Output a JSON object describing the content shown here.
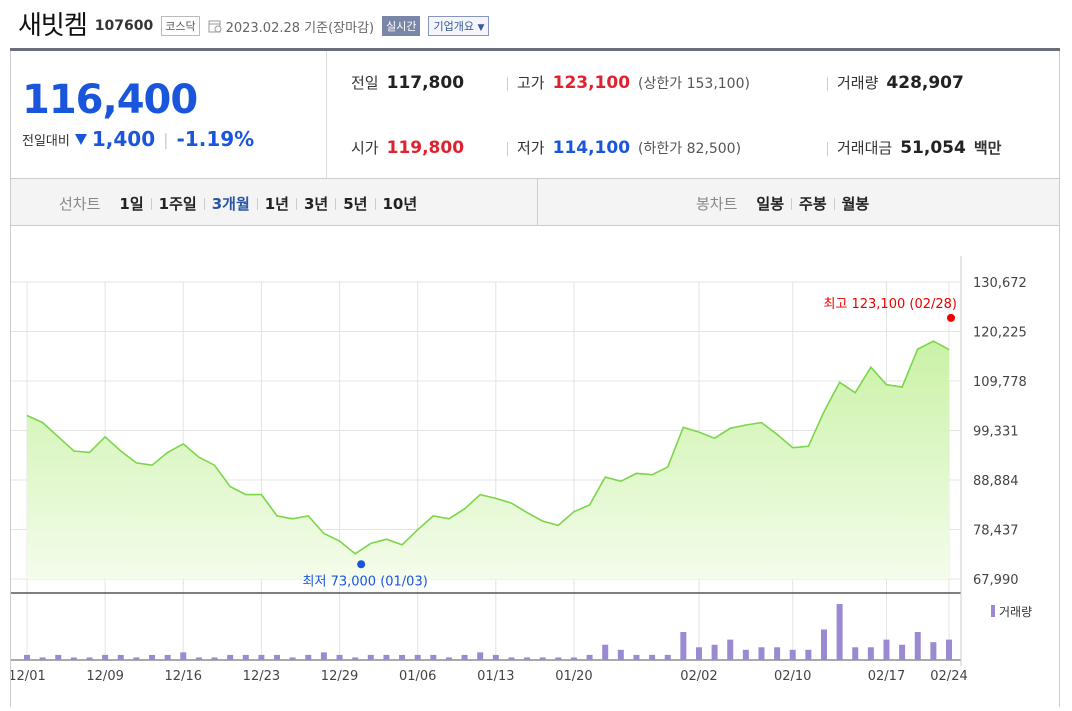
{
  "header": {
    "name": "새빗켐",
    "code": "107600",
    "market": "코스닥",
    "date_label": "2023.02.28  기준(장마감)",
    "live_label": "실시간",
    "corp_label": "기업개요"
  },
  "price": {
    "current": "116,400",
    "change_label": "전일대비",
    "change_amount": "1,400",
    "change_pct": "-1.19%"
  },
  "stats": {
    "prev_label": "전일",
    "prev_value": "117,800",
    "high_label": "고가",
    "high_value": "123,100",
    "upper_limit": "(상한가 153,100)",
    "volume_label": "거래량",
    "volume_value": "428,907",
    "open_label": "시가",
    "open_value": "119,800",
    "low_label": "저가",
    "low_value": "114,100",
    "lower_limit": "(하한가 82,500)",
    "amount_label": "거래대금",
    "amount_value": "51,054",
    "amount_unit": "백만"
  },
  "tabs": {
    "line_label": "선차트",
    "line": [
      "1일",
      "1주일",
      "3개월",
      "1년",
      "3년",
      "5년",
      "10년"
    ],
    "active": "3개월",
    "candle_label": "봉차트",
    "candle": [
      "일봉",
      "주봉",
      "월봉"
    ]
  },
  "chart_data": {
    "type": "area",
    "y_ticks": [
      "130,672",
      "120,225",
      "109,778",
      "99,331",
      "88,884",
      "78,437",
      "67,990"
    ],
    "ylim": [
      67990,
      130672
    ],
    "x_ticks": [
      "12/01",
      "12/09",
      "12/16",
      "12/23",
      "12/29",
      "01/06",
      "01/13",
      "01/20",
      "02/02",
      "02/10",
      "02/17",
      "02/24"
    ],
    "high_label": "최고 123,100 (02/28)",
    "low_label": "최저 73,000 (01/03)",
    "volume_label": "거래량",
    "colors": {
      "line": "#7cd64a",
      "fill_top": "#c9f2a6",
      "high": "#e00",
      "low": "#1a56db",
      "volume": "#9b8ad1"
    },
    "series": [
      {
        "values": [
          102500,
          101000,
          98000,
          95000,
          94700,
          98000,
          95000,
          92500,
          92000,
          94700,
          96500,
          93700,
          92000,
          87500,
          85800,
          85800,
          81300,
          80700,
          81300,
          77600,
          76000,
          73300,
          75500,
          76400,
          75200,
          78400,
          81300,
          80700,
          82800,
          85800,
          85000,
          84000,
          82000,
          80200,
          79300,
          82200,
          83600,
          89500,
          88600,
          90300,
          90000,
          91600,
          100000,
          99000,
          97700,
          99800,
          100500,
          101000,
          98500,
          95700,
          96000,
          103300,
          109500,
          107300,
          112700,
          109000,
          108500,
          116500,
          118200,
          116400
        ],
        "volume": [
          2,
          1,
          2,
          1,
          1,
          2,
          2,
          1,
          2,
          2,
          3,
          1,
          1,
          2,
          2,
          2,
          2,
          1,
          2,
          3,
          2,
          1,
          2,
          2,
          2,
          2,
          2,
          1,
          2,
          3,
          2,
          1,
          1,
          1,
          1,
          1,
          2,
          6,
          4,
          2,
          2,
          2,
          11,
          5,
          6,
          8,
          4,
          5,
          5,
          4,
          4,
          12,
          22,
          5,
          5,
          8,
          6,
          11,
          7,
          8
        ]
      }
    ]
  }
}
